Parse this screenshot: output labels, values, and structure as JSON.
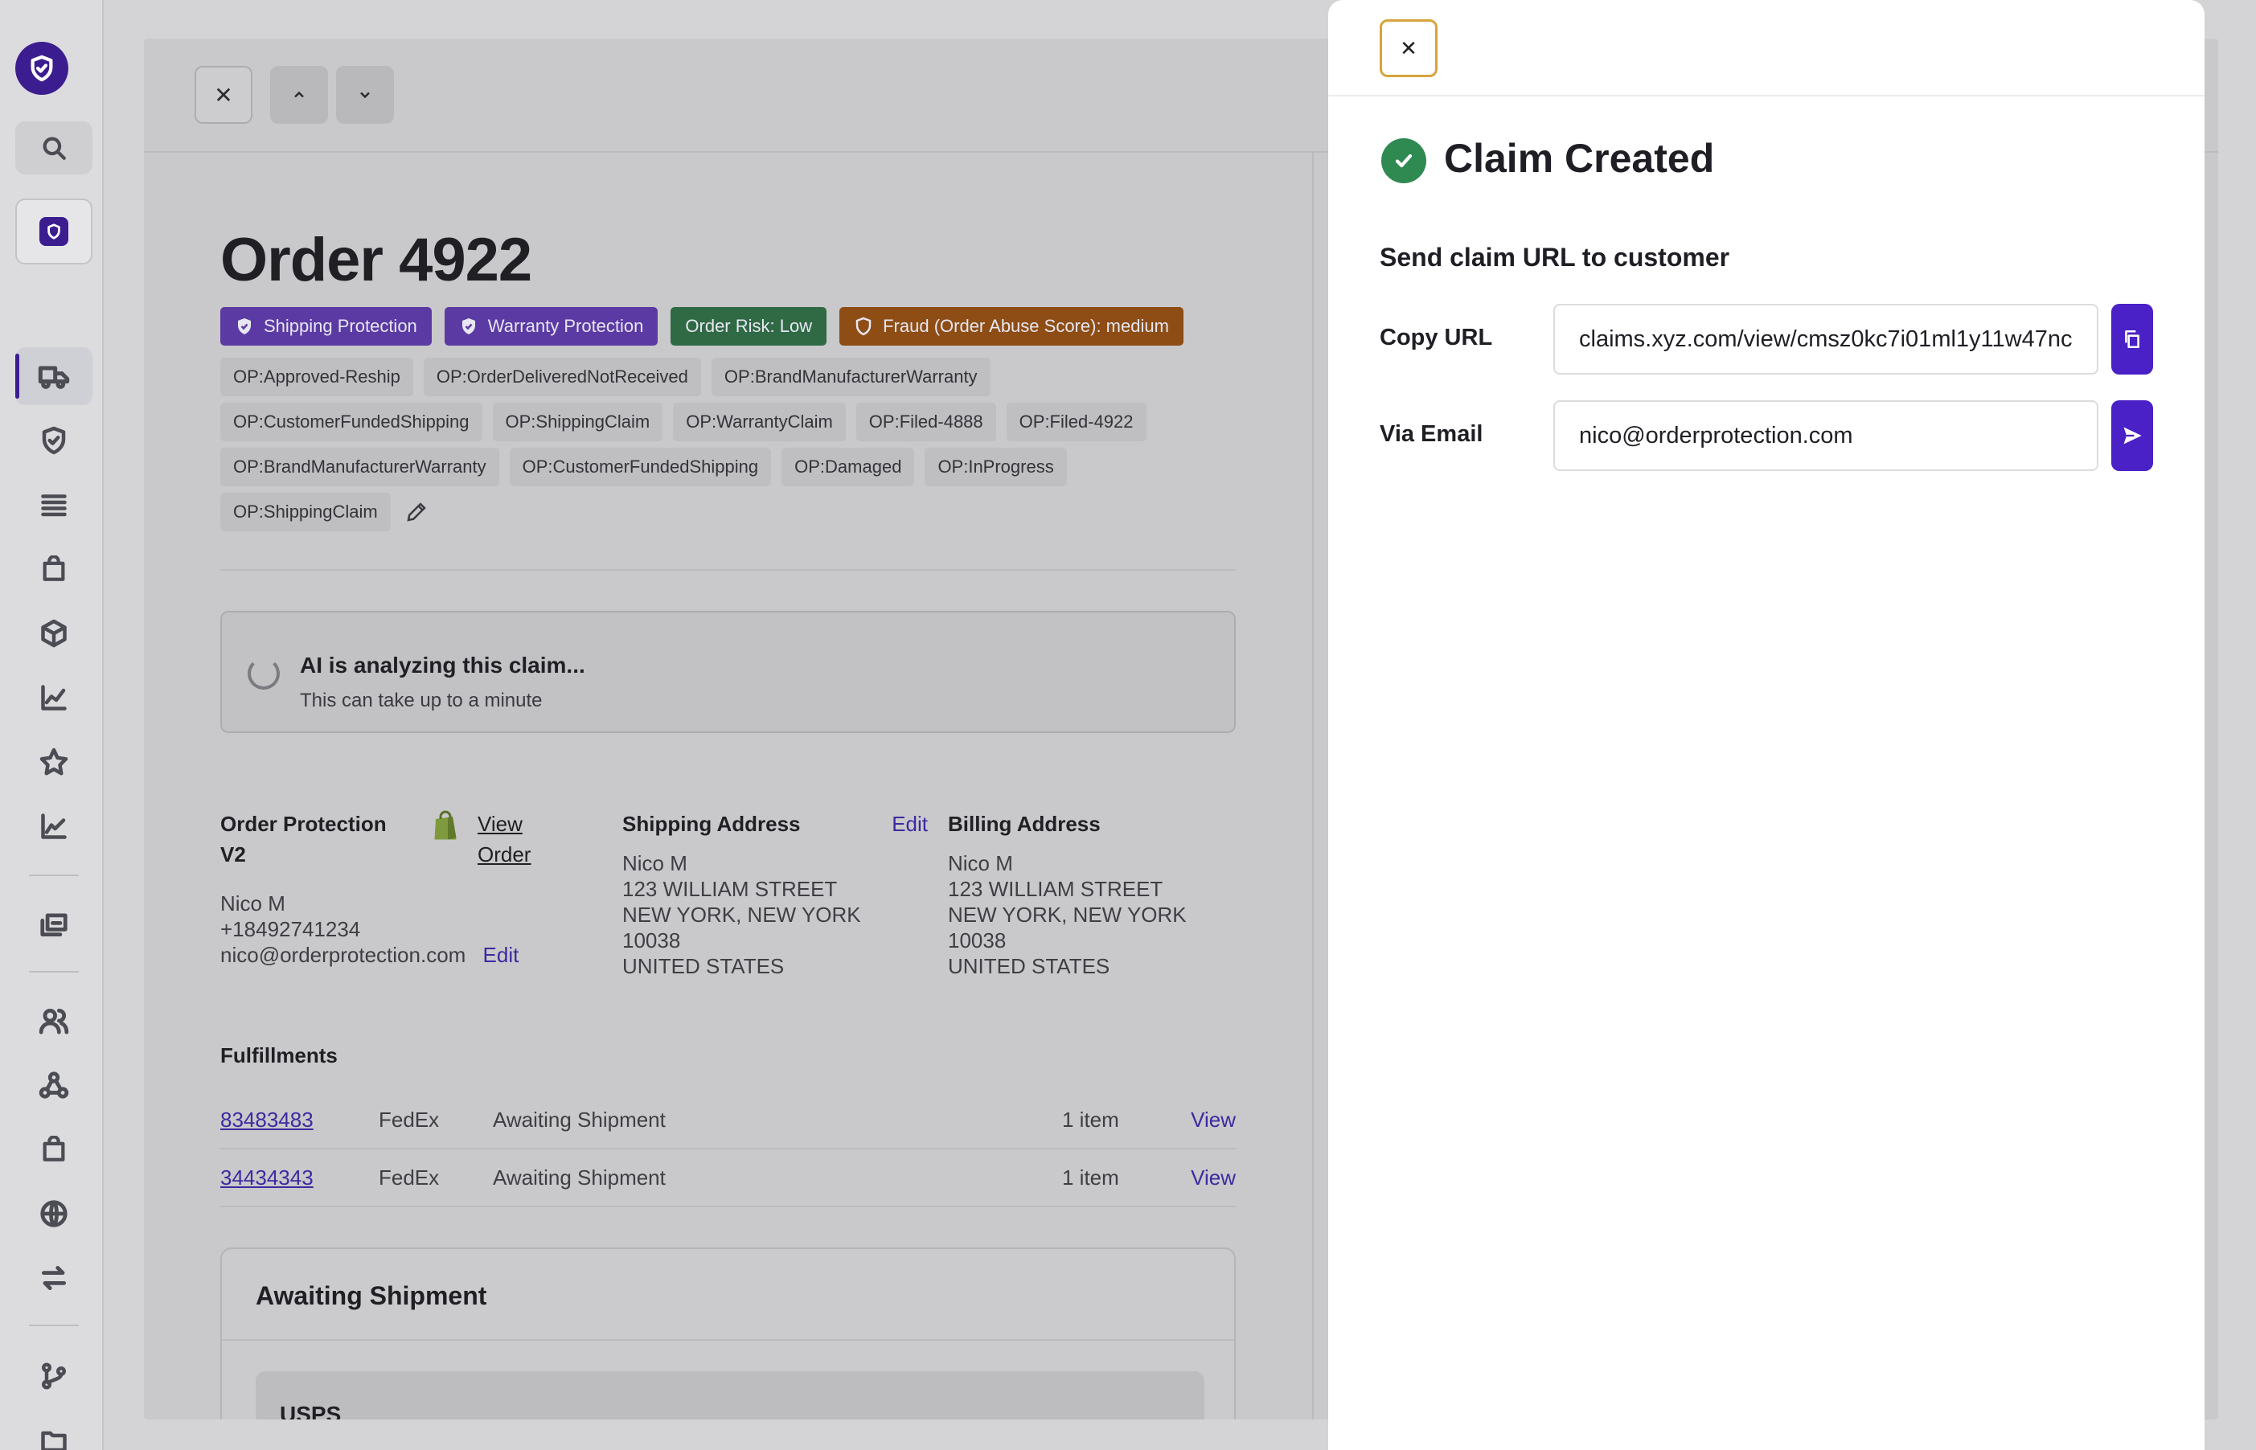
{
  "order": {
    "title": "Order 4922",
    "badges": [
      {
        "label": "Shipping Protection"
      },
      {
        "label": "Warranty Protection"
      },
      {
        "label": "Order Risk: Low"
      },
      {
        "label": "Fraud (Order Abuse Score): medium"
      }
    ],
    "tag_rows": [
      [
        "OP:Approved-Reship",
        "OP:OrderDeliveredNotReceived",
        "OP:BrandManufacturerWarranty"
      ],
      [
        "OP:CustomerFundedShipping",
        "OP:ShippingClaim",
        "OP:WarrantyClaim",
        "OP:Filed-4888",
        "OP:Filed-4922"
      ],
      [
        "OP:BrandManufacturerWarranty",
        "OP:CustomerFundedShipping",
        "OP:Damaged",
        "OP:InProgress"
      ],
      [
        "OP:ShippingClaim"
      ]
    ],
    "ai": {
      "title": "AI is analyzing this claim...",
      "subtitle": "This can take up to a minute"
    },
    "customer": {
      "store": "Order Protection V2",
      "view_order_1": "View",
      "view_order_2": "Order",
      "name": "Nico M",
      "phone": "+18492741234",
      "email": "nico@orderprotection.com",
      "edit": "Edit"
    },
    "shipping_address": {
      "heading": "Shipping Address",
      "edit": "Edit",
      "lines": [
        "Nico M",
        "123 WILLIAM STREET",
        "NEW YORK, NEW YORK",
        "10038",
        "UNITED STATES"
      ]
    },
    "billing_address": {
      "heading": "Billing Address",
      "lines": [
        "Nico M",
        "123 WILLIAM STREET",
        "NEW YORK, NEW YORK",
        "10038",
        "UNITED STATES"
      ]
    },
    "fulfillments": {
      "heading": "Fulfillments",
      "rows": [
        {
          "tracking": "83483483",
          "carrier": "FedEx",
          "status": "Awaiting Shipment",
          "items": "1 item",
          "action": "View"
        },
        {
          "tracking": "34434343",
          "carrier": "FedEx",
          "status": "Awaiting Shipment",
          "items": "1 item",
          "action": "View"
        }
      ]
    },
    "shipment_card": {
      "title": "Awaiting Shipment",
      "carrier": "USPS"
    }
  },
  "panel": {
    "title": "Claim Created",
    "subtitle": "Send claim URL to customer",
    "copy_url_label": "Copy URL",
    "copy_url_value": "claims.xyz.com/view/cmsz0kc7i01ml1y11w47nc",
    "email_label": "Via Email",
    "email_value": "nico@orderprotection.com"
  },
  "colors": {
    "brand": "#3b1d8f",
    "accent_button": "#4a20c7",
    "success": "#2f8a51",
    "badge_purple": "#5b3ba3",
    "badge_green": "#2f6a45",
    "badge_brown": "#8d4d14",
    "close_focus": "#d7a43a"
  },
  "icons": {
    "rail": [
      "logo-shield-icon",
      "search-icon",
      "app-shield-icon",
      "truck-icon",
      "shield-icon",
      "list-icon",
      "bag-icon",
      "box-icon",
      "chart-icon",
      "star-icon",
      "chart-icon",
      "stack-icon",
      "users-icon",
      "webhook-icon",
      "bag-icon",
      "globe-icon",
      "arrows-icon",
      "branch-icon",
      "folder-icon"
    ]
  }
}
